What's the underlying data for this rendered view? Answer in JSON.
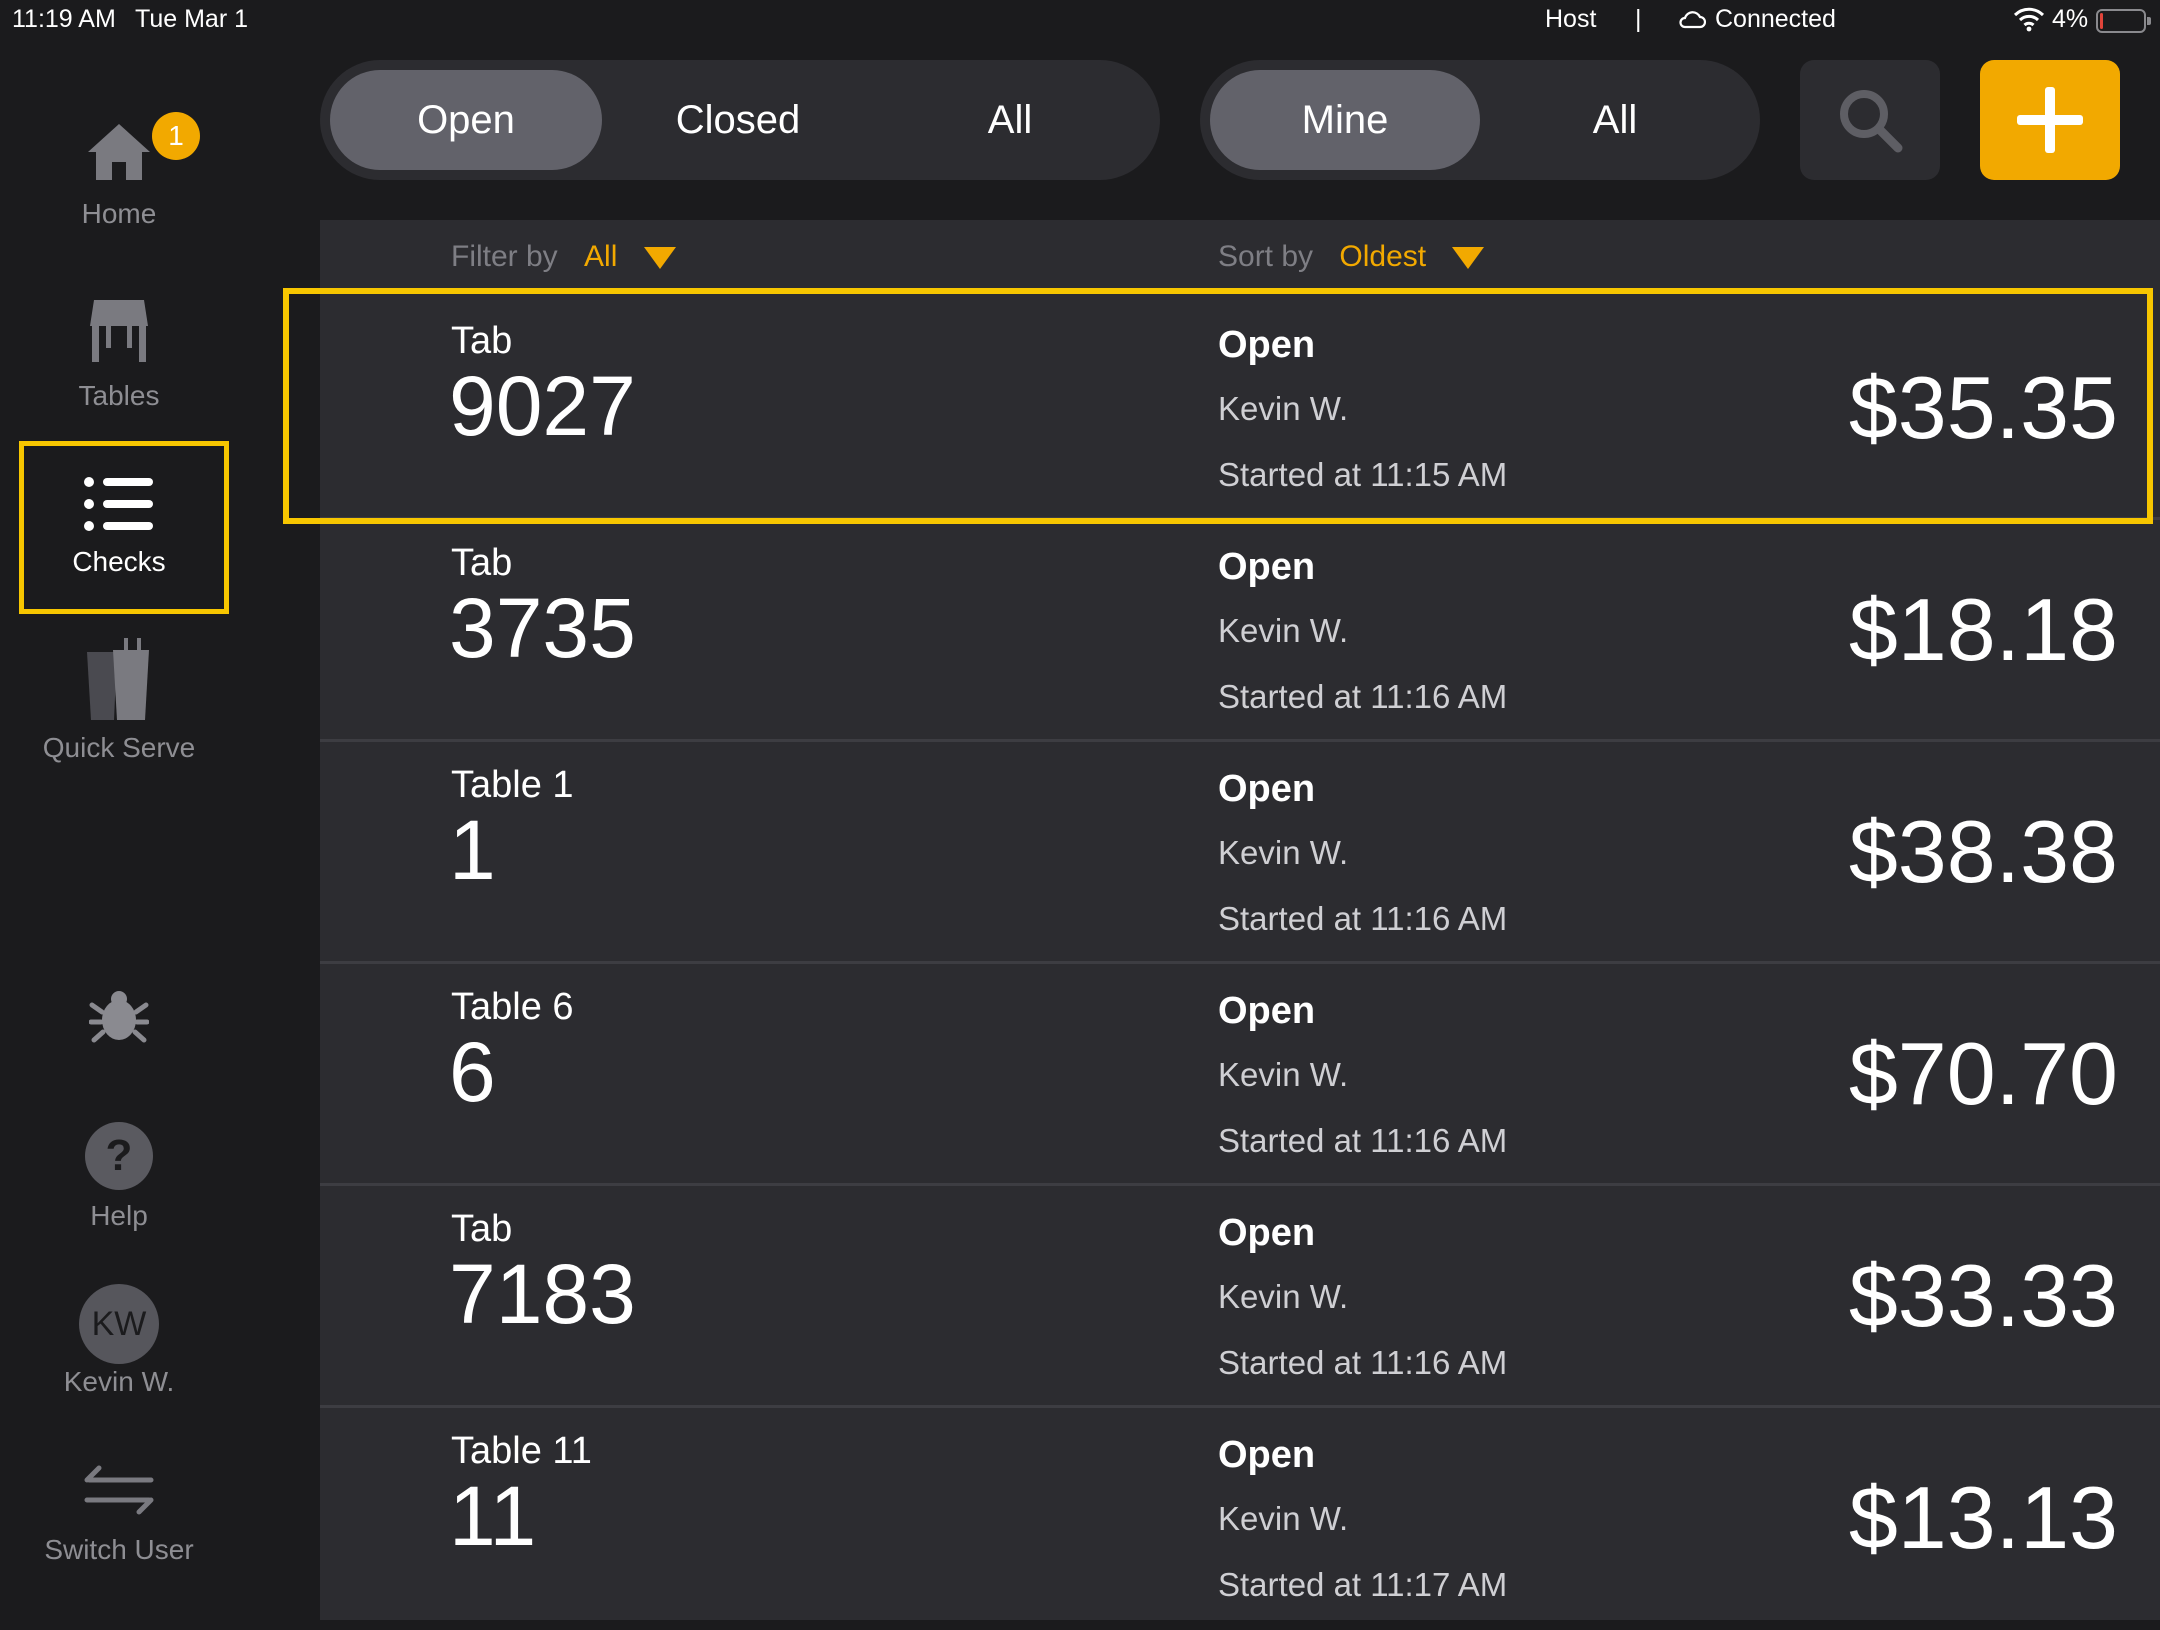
{
  "status_bar": {
    "time": "11:19 AM",
    "date": "Tue Mar 1",
    "role": "Host",
    "separator": "|",
    "connection": "Connected",
    "battery": "4%"
  },
  "sidebar": {
    "home": {
      "label": "Home",
      "badge": "1",
      "icon": "house-icon"
    },
    "tables": {
      "label": "Tables",
      "icon": "table-icon"
    },
    "checks": {
      "label": "Checks",
      "icon": "list-icon"
    },
    "quick_serve": {
      "label": "Quick Serve",
      "icon": "cups-icon"
    },
    "debug": {
      "icon": "bug-icon"
    },
    "help": {
      "label": "Help",
      "glyph": "?",
      "icon": "question-icon"
    },
    "user": {
      "label": "Kevin W.",
      "initials": "KW"
    },
    "switch_user": {
      "label": "Switch User",
      "icon": "swap-arrows-icon"
    }
  },
  "status_filter": {
    "options": [
      "Open",
      "Closed",
      "All"
    ],
    "selected": "Open"
  },
  "owner_filter": {
    "options": [
      "Mine",
      "All"
    ],
    "selected": "Mine"
  },
  "toolbar": {
    "search_icon": "search-icon",
    "add_icon": "plus-icon"
  },
  "list_controls": {
    "filter_label": "Filter by",
    "filter_value": "All",
    "sort_label": "Sort by",
    "sort_value": "Oldest"
  },
  "checks": [
    {
      "category": "Tab",
      "number": "9027",
      "status": "Open",
      "server": "Kevin W.",
      "started": "Started at 11:15 AM",
      "amount": "$35.35"
    },
    {
      "category": "Tab",
      "number": "3735",
      "status": "Open",
      "server": "Kevin W.",
      "started": "Started at 11:16 AM",
      "amount": "$18.18"
    },
    {
      "category": "Table 1",
      "number": "1",
      "status": "Open",
      "server": "Kevin W.",
      "started": "Started at 11:16 AM",
      "amount": "$38.38"
    },
    {
      "category": "Table 6",
      "number": "6",
      "status": "Open",
      "server": "Kevin W.",
      "started": "Started at 11:16 AM",
      "amount": "$70.70"
    },
    {
      "category": "Tab",
      "number": "7183",
      "status": "Open",
      "server": "Kevin W.",
      "started": "Started at 11:16 AM",
      "amount": "$33.33"
    },
    {
      "category": "Table 11",
      "number": "11",
      "status": "Open",
      "server": "Kevin W.",
      "started": "Started at 11:17 AM",
      "amount": "$13.13"
    }
  ],
  "colors": {
    "accent": "#f2a900",
    "highlight": "#f7c600",
    "panel": "#2c2c30",
    "background": "#1b1b1d",
    "selected_segment": "#62626a"
  }
}
